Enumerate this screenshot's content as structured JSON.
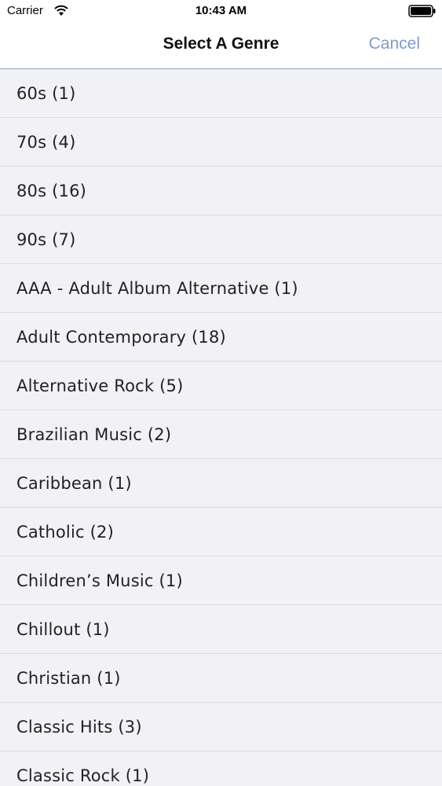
{
  "status_bar": {
    "carrier": "Carrier",
    "time": "10:43 AM",
    "wifi_icon": "wifi-icon",
    "battery_icon": "battery-icon"
  },
  "nav": {
    "title": "Select A Genre",
    "cancel_label": "Cancel",
    "accent_color": "#7c9bd0"
  },
  "genres": [
    "60s (1)",
    "70s (4)",
    "80s (16)",
    "90s (7)",
    "AAA - Adult Album Alternative (1)",
    "Adult Contemporary (18)",
    "Alternative Rock (5)",
    "Brazilian Music (2)",
    "Caribbean (1)",
    "Catholic (2)",
    "Children’s Music (1)",
    "Chillout (1)",
    "Christian (1)",
    "Classic Hits (3)",
    "Classic Rock (1)"
  ]
}
